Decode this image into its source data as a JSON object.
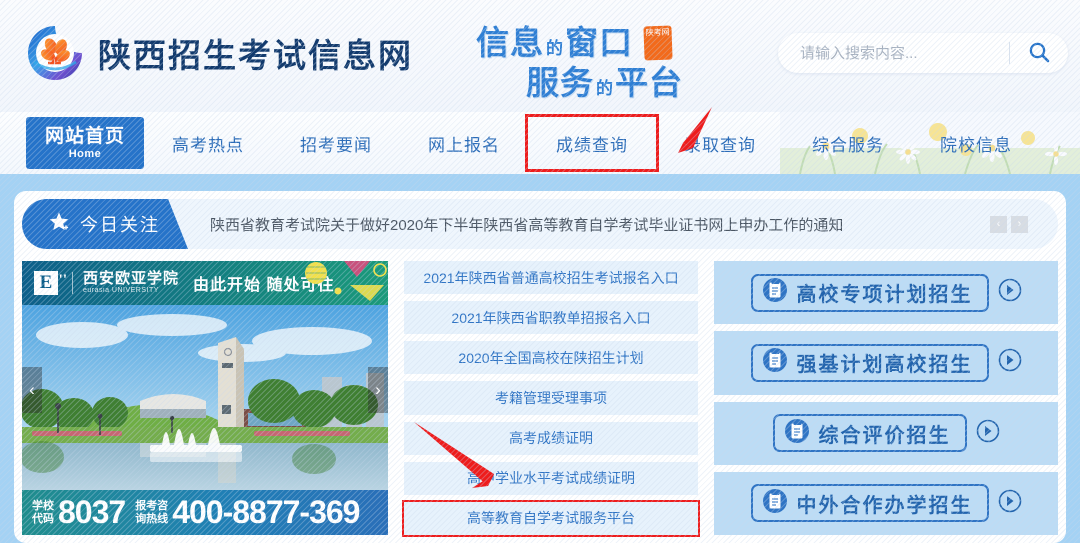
{
  "site": {
    "title": "陕西招生考试信息网",
    "logo_icon": "circle-flower-logo-icon"
  },
  "slogan": {
    "line1_big_a": "信息",
    "line1_small": "的",
    "line1_big_b": "窗口",
    "line2_big_a": "服务",
    "line2_small": "的",
    "line2_big_b": "平台",
    "seal_text": "陕考网"
  },
  "search": {
    "placeholder": "请输入搜索内容...",
    "value": "",
    "icon": "search-icon"
  },
  "nav": {
    "home": {
      "cn": "网站首页",
      "en": "Home"
    },
    "items": [
      {
        "label": "高考热点",
        "highlighted": false
      },
      {
        "label": "招考要闻",
        "highlighted": false
      },
      {
        "label": "网上报名",
        "highlighted": false
      },
      {
        "label": "成绩查询",
        "highlighted": true
      },
      {
        "label": "录取查询",
        "highlighted": false
      },
      {
        "label": "综合服务",
        "highlighted": false
      },
      {
        "label": "院校信息",
        "highlighted": false
      }
    ]
  },
  "notice": {
    "badge": "今日关注",
    "badge_icon": "star-icon",
    "text": "陕西省教育考试院关于做好2020年下半年陕西省高等教育自学考试毕业证书网上申办工作的通知",
    "prev": "‹",
    "next": "›"
  },
  "carousel": {
    "prev_icon": "chevron-left-icon",
    "next_icon": "chevron-right-icon",
    "ad_logo_letter": "E",
    "ad_university_cn": "西安欧亚学院",
    "ad_university_en": "eurasia UNIVERSITY",
    "ad_slogan": "由此开始 随处可往",
    "school_code_label": "学校\n代码",
    "school_code_label_l1": "学校",
    "school_code_label_l2": "代码",
    "school_code": "8037",
    "hotline_label_l1": "报考咨",
    "hotline_label_l2": "询热线",
    "hotline": "400-8877-369"
  },
  "links": [
    {
      "label": "2021年陕西省普通高校招生考试报名入口",
      "highlighted": false
    },
    {
      "label": "2021年陕西省职教单招报名入口",
      "highlighted": false
    },
    {
      "label": "2020年全国高校在陕招生计划",
      "highlighted": false
    },
    {
      "label": "考籍管理受理事项",
      "highlighted": false
    },
    {
      "label": "高考成绩证明",
      "highlighted": false
    },
    {
      "label": "高中学业水平考试成绩证明",
      "highlighted": false
    },
    {
      "label": "高等教育自学考试服务平台",
      "highlighted": true
    }
  ],
  "panel": [
    {
      "label": "高校专项计划招生",
      "icon": "document-card-icon",
      "go_icon": "arrow-right-circle-icon"
    },
    {
      "label": "强基计划高校招生",
      "icon": "document-card-icon",
      "go_icon": "arrow-right-circle-icon"
    },
    {
      "label": "综合评价招生",
      "icon": "document-card-icon",
      "go_icon": "arrow-right-circle-icon"
    },
    {
      "label": "中外合作办学招生",
      "icon": "document-card-icon",
      "go_icon": "arrow-right-circle-icon"
    }
  ],
  "annotations": {
    "arrow_color": "#ee1c1c",
    "box_color": "#ee1c1c"
  },
  "colors": {
    "primary_blue": "#2573c9",
    "link_blue": "#2f74c4",
    "content_bg": "#a4d2f4",
    "panel_bg": "#bcdcf5",
    "accent_red": "#ee1c1c"
  }
}
